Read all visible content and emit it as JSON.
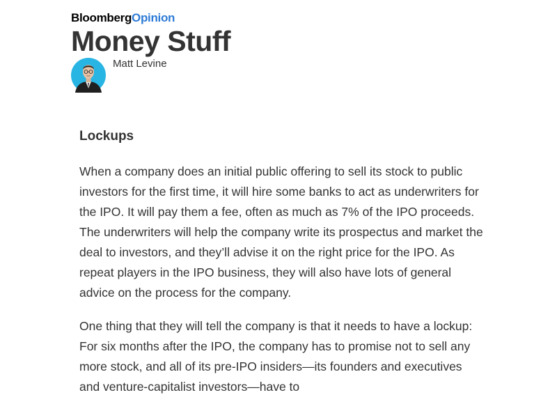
{
  "brand": {
    "main": "Bloomberg",
    "sub": "Opinion"
  },
  "newsletter": {
    "title": "Money Stuff"
  },
  "author": {
    "name": "Matt Levine"
  },
  "article": {
    "section_heading": "Lockups",
    "paragraphs": [
      "When a company does an initial public offering to sell its stock to public investors for the first time, it will hire some banks to act as underwriters for the IPO. It will pay them a fee, often as much as 7% of the IPO proceeds. The underwriters will help the company write its prospectus and market the deal to investors, and they’ll advise it on the right price for the IPO. As repeat players in the IPO business, they will also have lots of general advice on the process for the company.",
      "One thing that they will tell the company is that it needs to have a lockup: For six months after the IPO, the company has to promise not to sell any more stock, and all of its pre-IPO insiders—its founders and executives and venture-capitalist investors—have to"
    ]
  },
  "colors": {
    "brand_accent": "#2e7bd6",
    "avatar_bg": "#29b5e3",
    "text": "#333333"
  }
}
